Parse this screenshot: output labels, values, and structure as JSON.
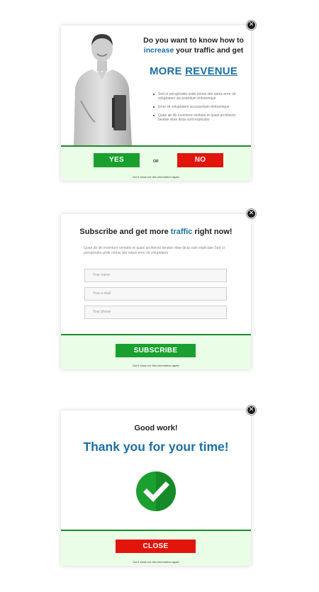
{
  "popup1": {
    "headline_part1": "Do you want to know how to",
    "headline_highlight": "increase",
    "headline_part2": " your traffic and get",
    "big_prefix": "MORE ",
    "big_underline": "REVENUE",
    "bullets": [
      "Sed ut perspiciatis unde omnis iste natus error sit voluptatem accusantium doloremque",
      "Error sit voluptatem accusantium doloremque",
      "Quae ab illo inventore veritatis et quasi architecto beatae vitae dicta sunt explicabo"
    ],
    "yes_label": "YES",
    "or_label": "OR",
    "no_label": "NO",
    "dont_show": "Don't show me this information again"
  },
  "popup2": {
    "title_part1": "Subscribe and get more ",
    "title_highlight": "traffic",
    "title_part2": " right now!",
    "description": "Quae ab illo inventore veritatis et quasi architecto beatae vitae dicta sunt explicabo Sed ut perspiciatis unde omnis iste natus error sit voluptatem",
    "name_placeholder": "Your name",
    "email_placeholder": "Your e-mail",
    "phone_placeholder": "Your phone",
    "subscribe_label": "SUBSCRIBE",
    "dont_show": "Don't show me this information again"
  },
  "popup3": {
    "good_work": "Good work!",
    "thanks": "Thank you for your time!",
    "close_label": "CLOSE",
    "dont_show": "Don't show me this information again"
  },
  "close_glyph": "✕",
  "icons": {
    "close": "close-icon",
    "check": "check-circle-icon",
    "bullet": "bullet-icon"
  },
  "colors": {
    "accent": "#1c6fa6",
    "green": "#1aa02f",
    "red": "#e2150c",
    "footer_bg": "#eafde6"
  }
}
